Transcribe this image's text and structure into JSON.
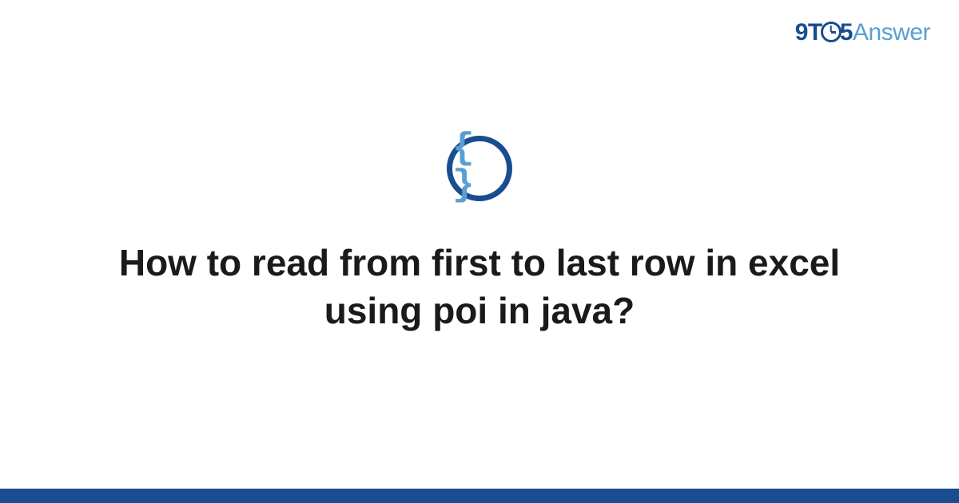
{
  "logo": {
    "part1": "9T",
    "part2": "5",
    "part3": "Answer"
  },
  "category_icon": {
    "symbol": "{ }",
    "name": "code-braces"
  },
  "question": {
    "title": "How to read from first to last row in excel using poi in java?"
  },
  "colors": {
    "primary": "#1a4d8f",
    "accent": "#5a9fd4"
  }
}
